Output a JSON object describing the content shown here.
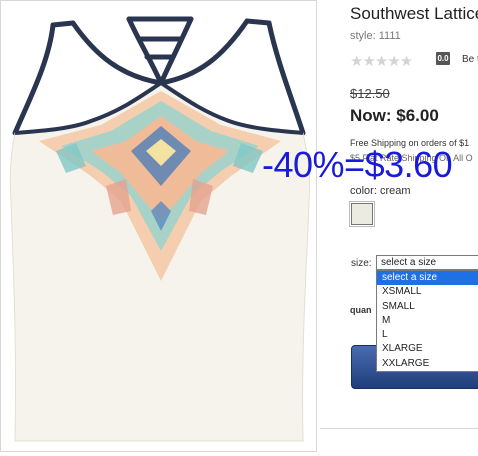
{
  "product": {
    "title": "Southwest Lattice",
    "style": "style: 1111",
    "stars": "★★★★★",
    "rating": "0.0",
    "review_link": "Be t",
    "old_price": "$12.50",
    "now_price": "Now: $6.00",
    "shipping_line1": "Free Shipping on orders of $1",
    "shipping_line2": "$5 Flat Rate Shipping On All O",
    "overlay_text": "-40%=$3.60",
    "color_label": "color: cream",
    "swatch_color": "#ecebe2",
    "size_label": "size:",
    "size_selected": "select a size",
    "size_options": [
      "select a size",
      "XSMALL",
      "SMALL",
      "M",
      "L",
      "XLARGE",
      "XXLARGE"
    ],
    "quantity_label": "quan",
    "image_icon": "tank-top-image"
  },
  "colors": {
    "strap": "#2a3550",
    "garment": "#f5f3eb",
    "accent_blue": "#1a1adb",
    "select_highlight": "#1f6fe5",
    "button": "#2b4b8c"
  }
}
